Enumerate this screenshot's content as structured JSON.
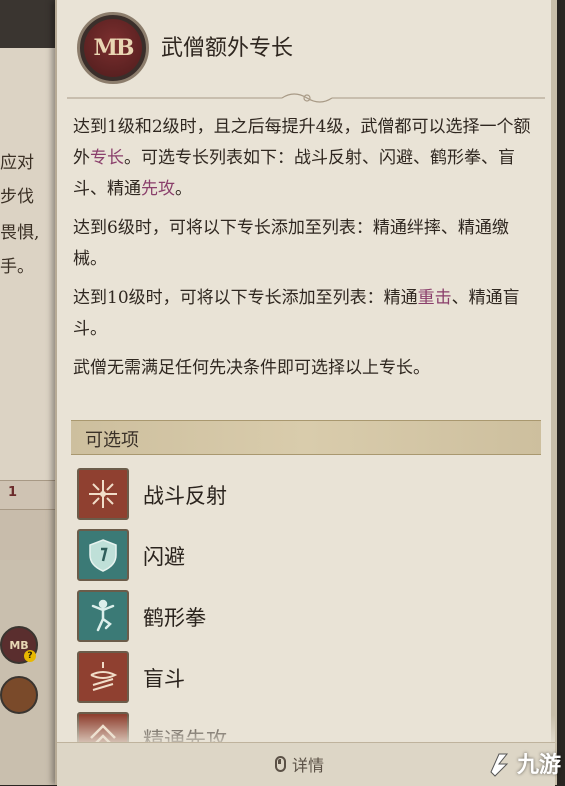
{
  "background": {
    "lines": [
      "应对",
      "步伐",
      "畏惧,",
      "手。"
    ],
    "bar_number": "1",
    "badge": "MB"
  },
  "feature": {
    "icon_text": "MB",
    "title": "武僧额外专长",
    "paragraphs": [
      {
        "parts": [
          {
            "text": "达到1级和2级时，且之后每提升4级，武僧都可以选择一个额外"
          },
          {
            "text": "专长",
            "hl": true
          },
          {
            "text": "。可选专长列表如下：战斗反射、闪避、鹤形拳、盲斗、精通"
          },
          {
            "text": "先攻",
            "hl": true
          },
          {
            "text": "。"
          }
        ]
      },
      {
        "parts": [
          {
            "text": "达到6级时，可将以下专长添加至列表：精通绊摔、精通缴械。"
          }
        ]
      },
      {
        "parts": [
          {
            "text": "达到10级时，可将以下专长添加至列表：精通"
          },
          {
            "text": "重击",
            "hl": true
          },
          {
            "text": "、精通盲斗。"
          }
        ]
      },
      {
        "parts": [
          {
            "text": "武僧无需满足任何先决条件即可选择以上专长。"
          }
        ]
      }
    ]
  },
  "options": {
    "header": "可选项",
    "items": [
      {
        "label": "战斗反射",
        "icon": "combat-reflexes-icon",
        "color": "red"
      },
      {
        "label": "闪避",
        "icon": "dodge-icon",
        "color": "teal"
      },
      {
        "label": "鹤形拳",
        "icon": "crane-style-icon",
        "color": "teal"
      },
      {
        "label": "盲斗",
        "icon": "blind-fight-icon",
        "color": "red"
      },
      {
        "label": "精通先攻",
        "icon": "improved-initiative-icon",
        "color": "red"
      }
    ]
  },
  "footer": {
    "detail_label": "详情"
  },
  "watermark": {
    "text": "九游"
  },
  "colors": {
    "highlight": "#8a3f6b",
    "panel": "#e9e3d6",
    "red_icon": "#8f4030",
    "teal_icon": "#3b7a76"
  }
}
